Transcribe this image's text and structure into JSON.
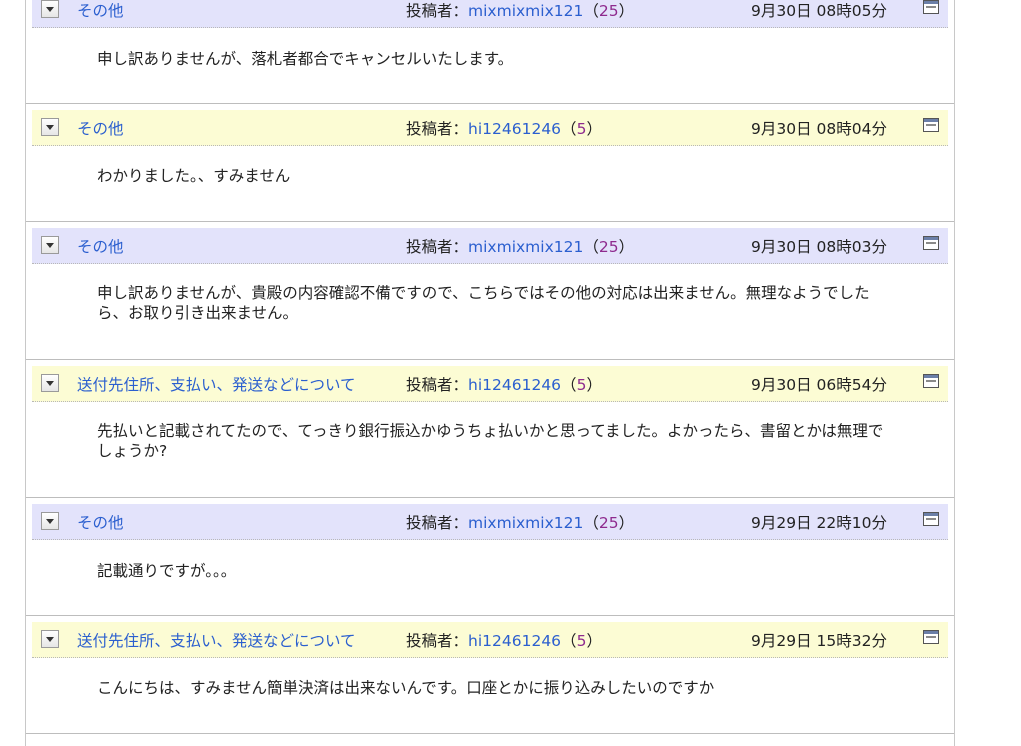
{
  "poster_label": "投稿者：",
  "icons": {
    "toggle": "dropdown-toggle-icon",
    "window": "window-icon"
  },
  "colors": {
    "question_header": "#e3e3fb",
    "answer_header": "#fcfcd4",
    "link": "#2b5fcf",
    "rating": "#8e2a8e"
  },
  "messages": [
    {
      "category": "その他",
      "user": "mixmixmix121",
      "rating": "25",
      "date": "9月30日 08時05分",
      "body": "申し訳ありませんが、落札者都合でキャンセルいたします。"
    },
    {
      "category": "その他",
      "user": "hi12461246",
      "rating": "5",
      "date": "9月30日 08時04分",
      "body": "わかりました。、すみません"
    },
    {
      "category": "その他",
      "user": "mixmixmix121",
      "rating": "25",
      "date": "9月30日 08時03分",
      "body": "申し訳ありませんが、貴殿の内容確認不備ですので、こちらではその他の対応は出来ません。無理なようでしたら、お取り引き出来ません。"
    },
    {
      "category": "送付先住所、支払い、発送などについて",
      "user": "hi12461246",
      "rating": "5",
      "date": "9月30日 06時54分",
      "body": "先払いと記載されてたので、てっきり銀行振込かゆうちょ払いかと思ってました。よかったら、書留とかは無理でしょうか?"
    },
    {
      "category": "その他",
      "user": "mixmixmix121",
      "rating": "25",
      "date": "9月29日 22時10分",
      "body": "記載通りですが。。。"
    },
    {
      "category": "送付先住所、支払い、発送などについて",
      "user": "hi12461246",
      "rating": "5",
      "date": "9月29日 15時32分",
      "body": "こんにちは、すみません簡単決済は出来ないんです。口座とかに振り込みしたいのですか"
    }
  ]
}
